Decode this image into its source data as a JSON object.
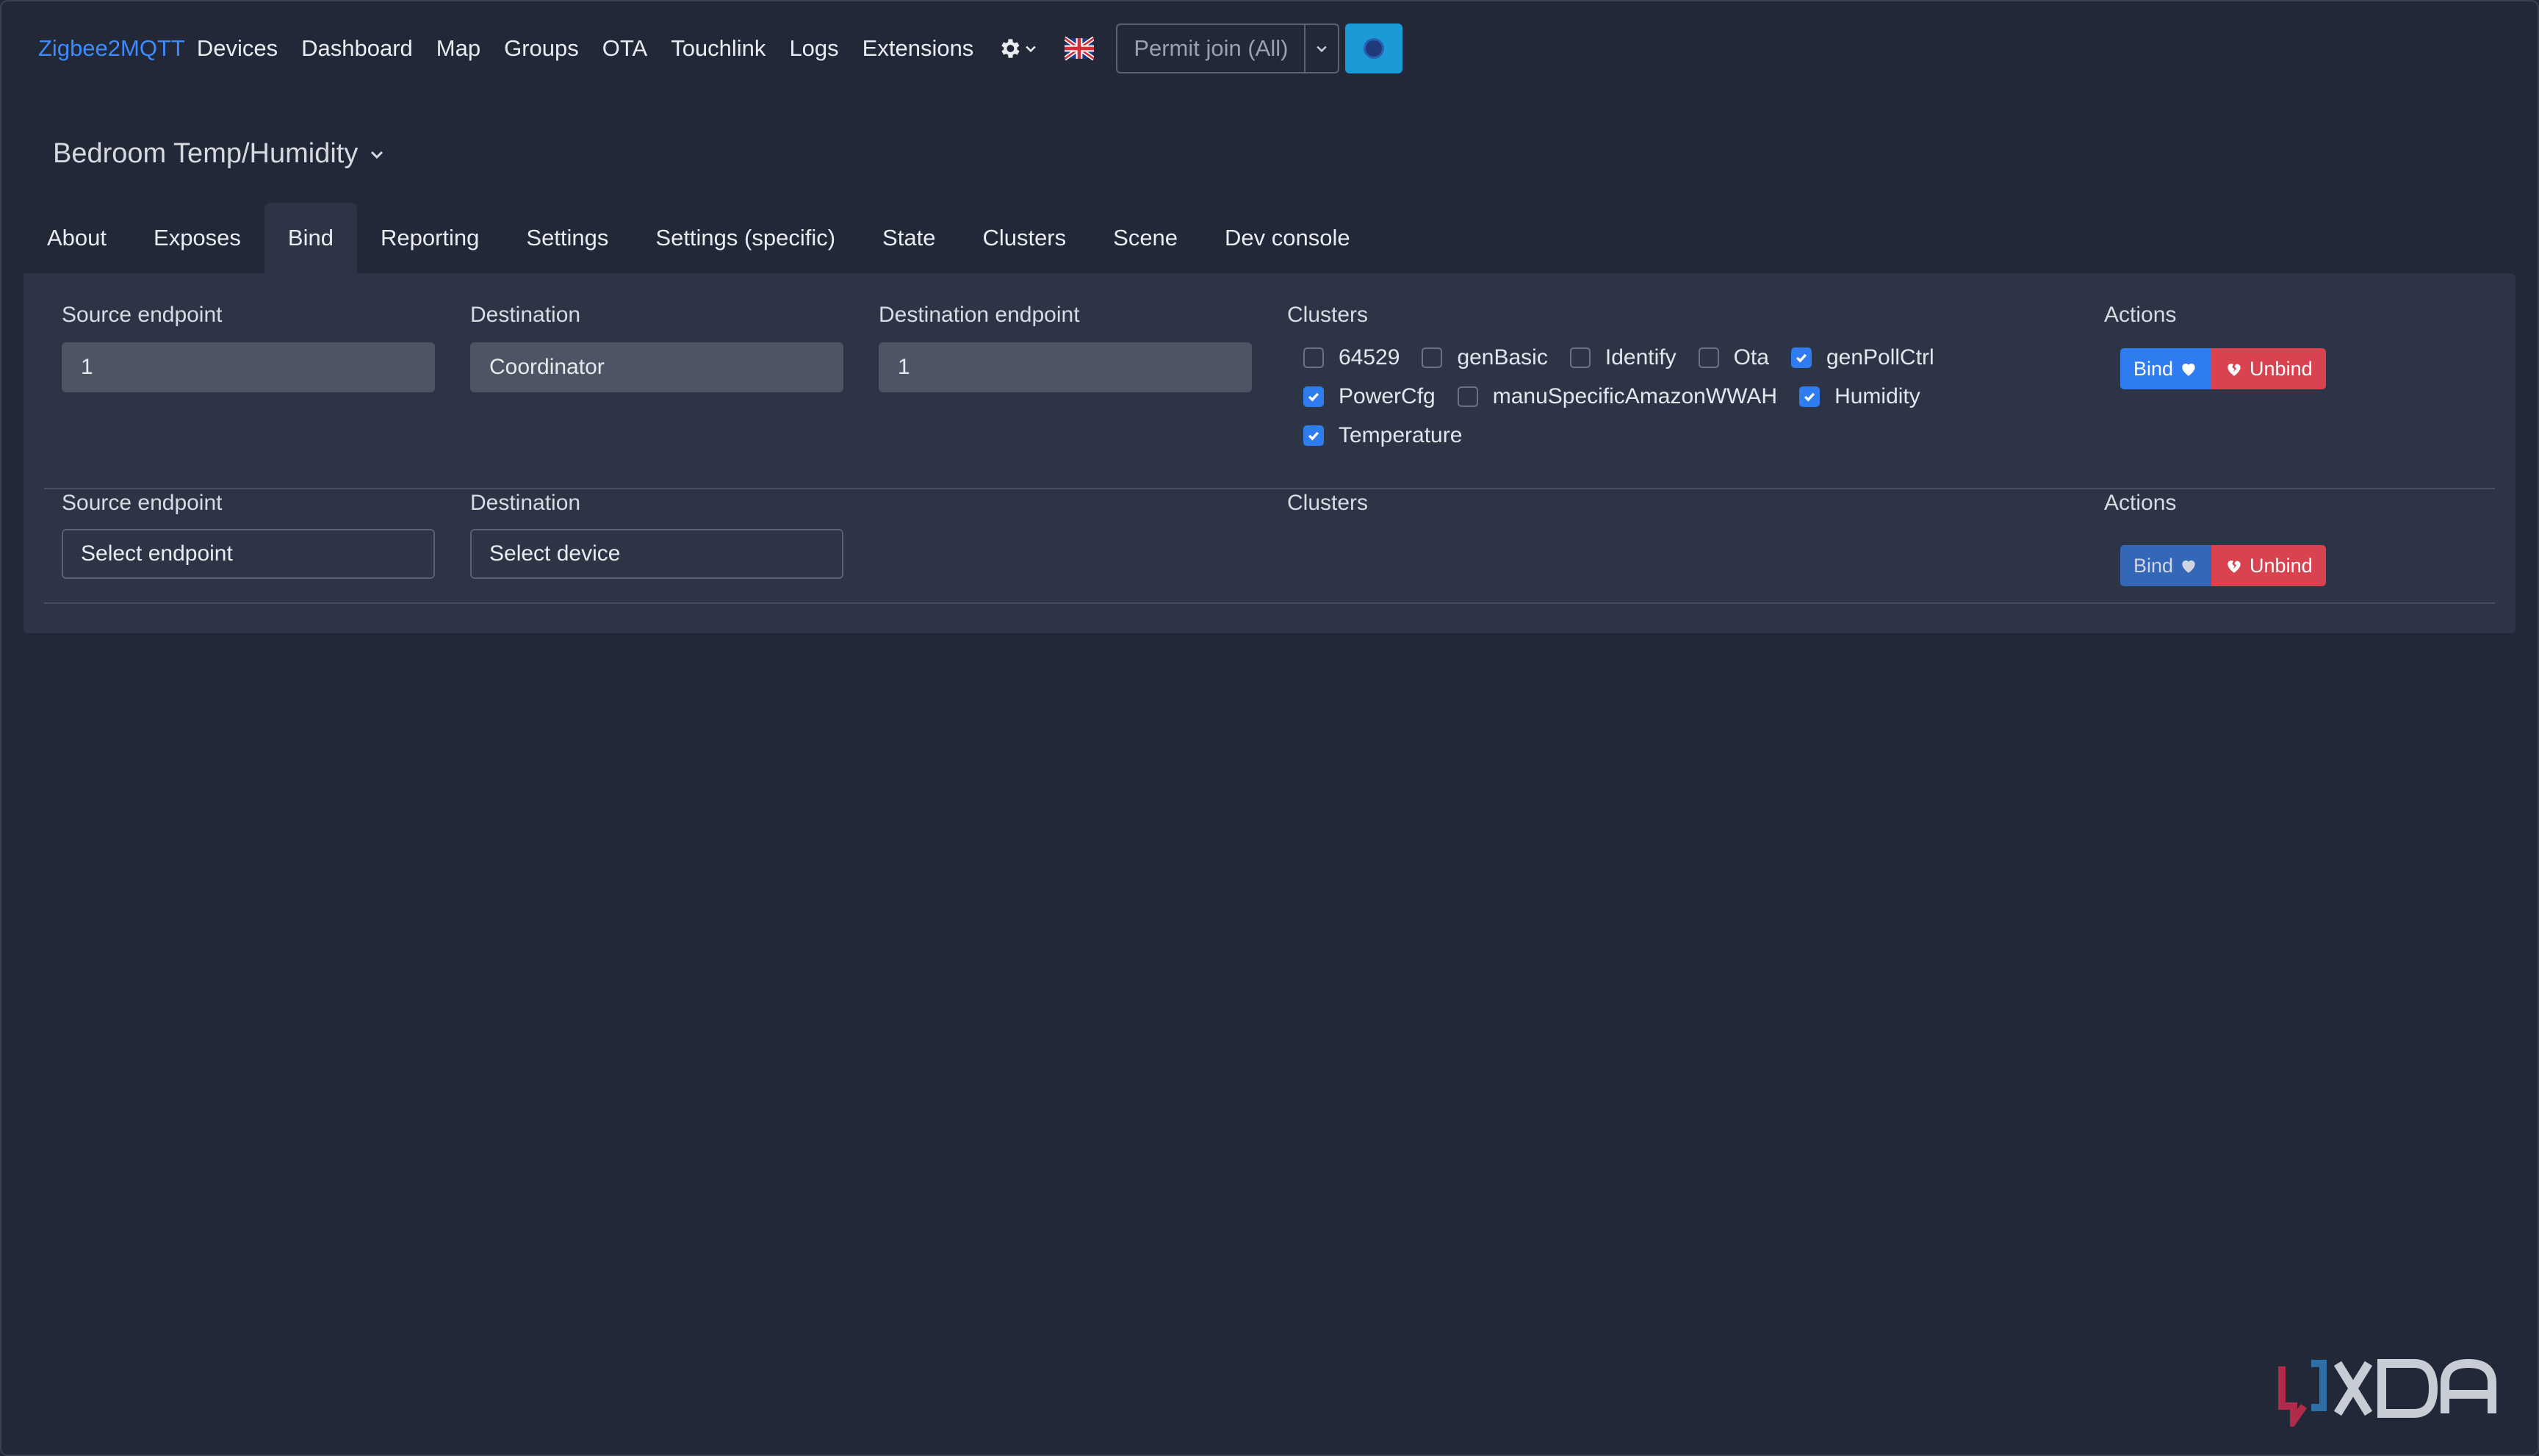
{
  "nav": {
    "brand": "Zigbee2MQTT",
    "links": [
      "Devices",
      "Dashboard",
      "Map",
      "Groups",
      "OTA",
      "Touchlink",
      "Logs",
      "Extensions"
    ],
    "permit_join": "Permit join (All)"
  },
  "device": {
    "title": "Bedroom Temp/Humidity"
  },
  "tabs": [
    "About",
    "Exposes",
    "Bind",
    "Reporting",
    "Settings",
    "Settings (specific)",
    "State",
    "Clusters",
    "Scene",
    "Dev console"
  ],
  "bind_rows": [
    {
      "source_label": "Source endpoint",
      "source_value": "1",
      "destination_label": "Destination",
      "destination_value": "Coordinator",
      "dest_endpoint_label": "Destination endpoint",
      "dest_endpoint_value": "1",
      "clusters_label": "Clusters",
      "actions_label": "Actions",
      "clusters": [
        {
          "name": "64529",
          "checked": false
        },
        {
          "name": "genBasic",
          "checked": false
        },
        {
          "name": "Identify",
          "checked": false
        },
        {
          "name": "Ota",
          "checked": false
        },
        {
          "name": "genPollCtrl",
          "checked": true
        },
        {
          "name": "PowerCfg",
          "checked": true
        },
        {
          "name": "manuSpecificAmazonWWAH",
          "checked": false
        },
        {
          "name": "Humidity",
          "checked": true
        },
        {
          "name": "Temperature",
          "checked": true
        }
      ],
      "bind_label": "Bind",
      "unbind_label": "Unbind"
    },
    {
      "source_label": "Source endpoint",
      "source_value": "Select endpoint",
      "destination_label": "Destination",
      "destination_value": "Select device",
      "clusters_label": "Clusters",
      "actions_label": "Actions",
      "bind_label": "Bind",
      "unbind_label": "Unbind"
    }
  ],
  "colors": {
    "background": "#222838",
    "panel": "#2d3445",
    "accent": "#2f7cf0",
    "danger": "#d9434f",
    "brand": "#3d8bfd"
  }
}
